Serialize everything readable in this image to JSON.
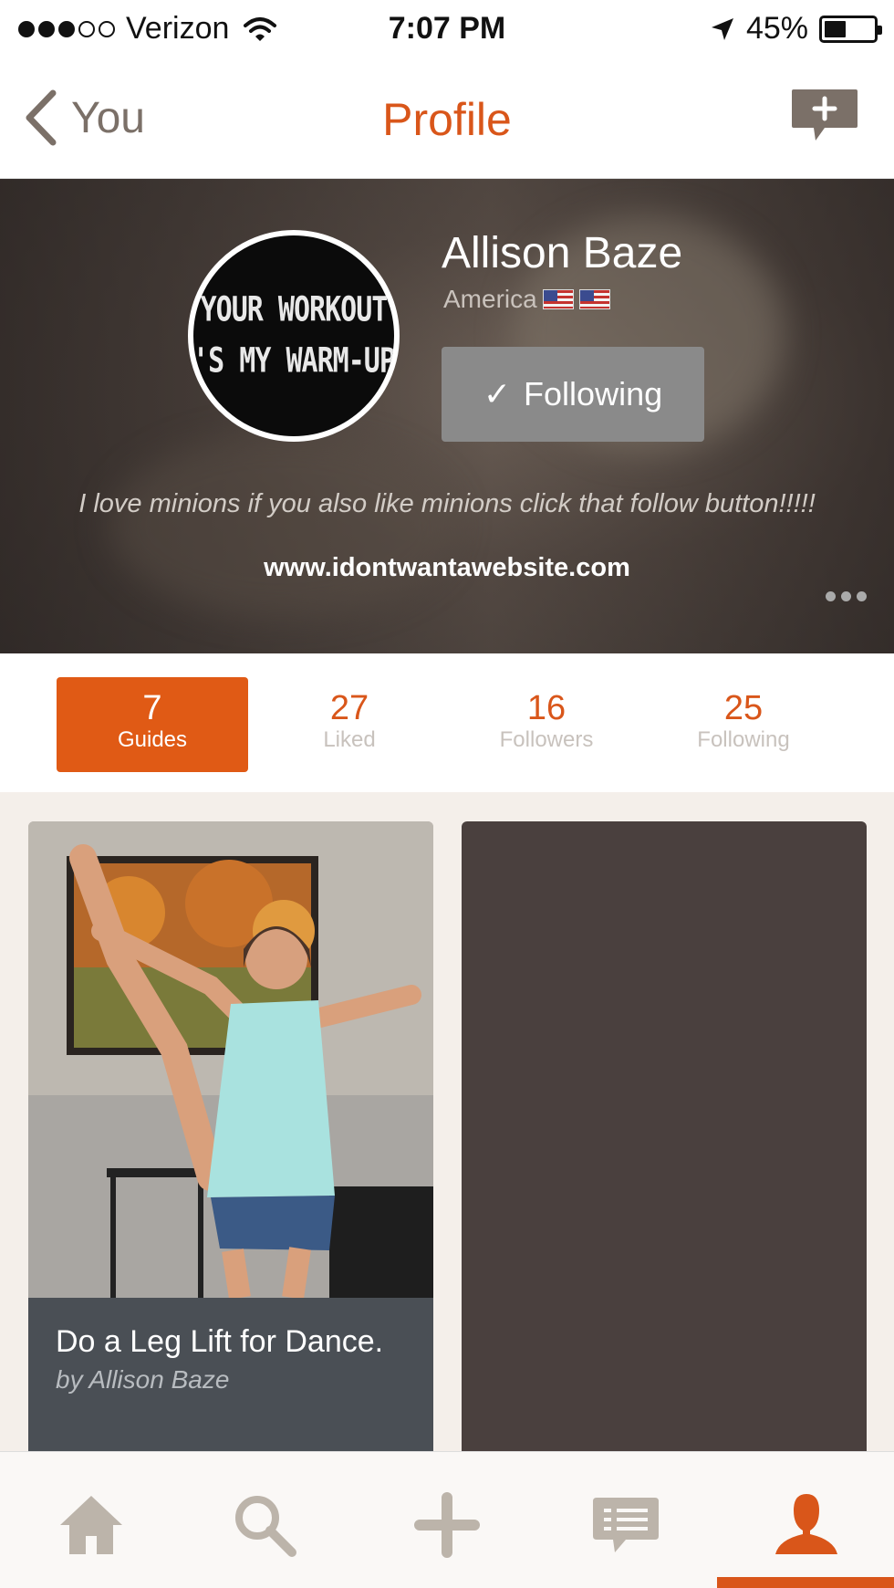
{
  "status_bar": {
    "carrier": "Verizon",
    "time": "7:07 PM",
    "battery": "45%",
    "battery_level": 0.45
  },
  "nav": {
    "back_label": "You",
    "title": "Profile",
    "action_icon": "new-message-icon"
  },
  "profile": {
    "name": "Allison Baze",
    "location": "America",
    "avatar_lines": [
      "YOUR WORKOUT",
      "'S MY WARM-UP"
    ],
    "following_label": "Following",
    "bio": "I love minions if you also like minions  click that follow button!!!!!",
    "website": "www.idontwantawebsite.com"
  },
  "stats": [
    {
      "value": "7",
      "label": "Guides",
      "active": true
    },
    {
      "value": "27",
      "label": "Liked",
      "active": false
    },
    {
      "value": "16",
      "label": "Followers",
      "active": false
    },
    {
      "value": "25",
      "label": "Following",
      "active": false
    }
  ],
  "guides": [
    {
      "title": "Do a Leg Lift for Dance.",
      "author": "by Allison Baze"
    }
  ],
  "tabs": [
    "home-icon",
    "search-icon",
    "add-icon",
    "messages-icon",
    "profile-icon"
  ],
  "colors": {
    "accent": "#d9561a",
    "muted": "#7b7068",
    "header_bg": "#4a403b"
  }
}
